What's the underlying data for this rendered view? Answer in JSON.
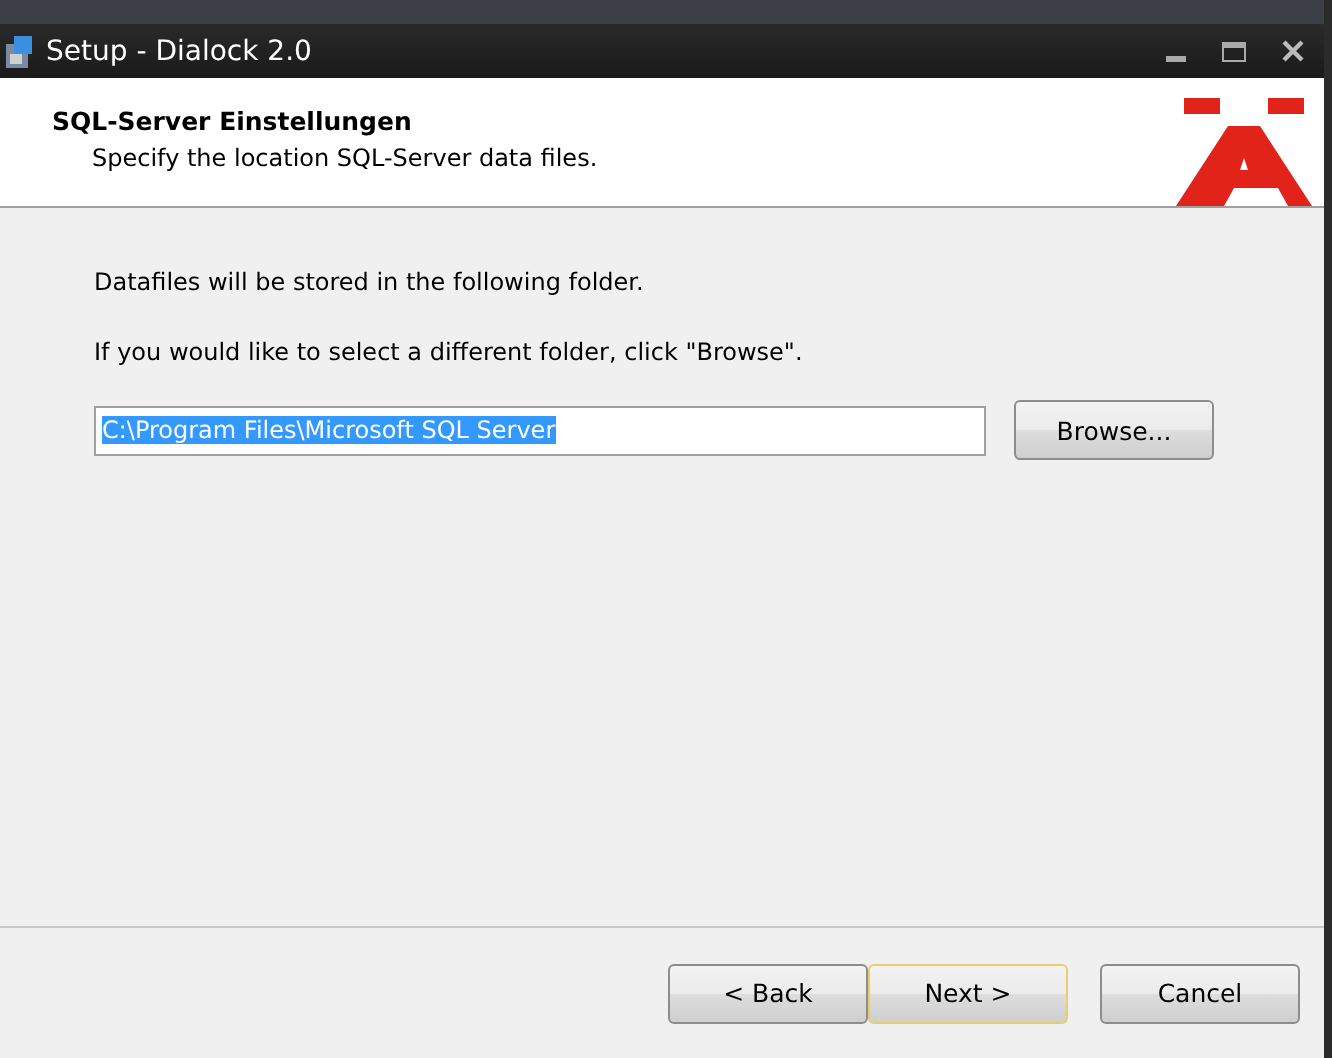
{
  "window": {
    "title": "Setup - Dialock 2.0"
  },
  "header": {
    "title": "SQL-Server Einstellungen",
    "subtitle": "Specify the location SQL-Server data files."
  },
  "body": {
    "lines": [
      "Datafiles will be stored in the following folder.",
      "If you would like to select a different folder, click \"Browse\"."
    ],
    "folder_field": {
      "value": "C:\\Program Files\\Microsoft SQL Server",
      "text_selected": true
    },
    "browse_button": "Browse..."
  },
  "buttons": [
    {
      "label": "< Back",
      "default": false
    },
    {
      "label": "Next >",
      "default": true
    },
    {
      "label": "Cancel",
      "default": false
    }
  ]
}
